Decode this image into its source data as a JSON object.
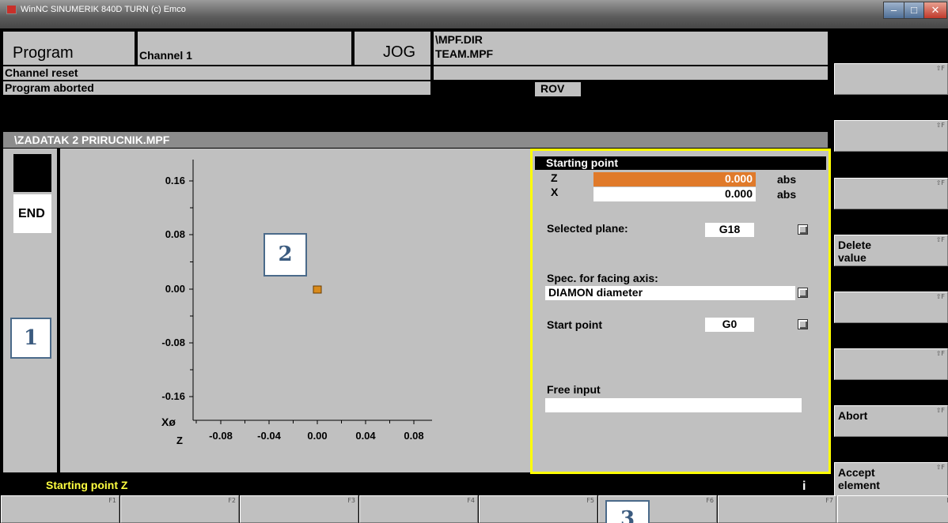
{
  "window": {
    "title": "WinNC SINUMERIK 840D TURN (c) Emco"
  },
  "header": {
    "area": "Program",
    "channel": "Channel 1",
    "mode": "JOG",
    "path_dir": "\\MPF.DIR",
    "path_file": "TEAM.MPF",
    "channel_status": "Channel reset",
    "program_status": "Program aborted",
    "rov": "ROV"
  },
  "program": {
    "file": "\\ZADATAK 2 PRIRUCNIK.MPF",
    "end_label": "END"
  },
  "plot": {
    "y_axis_label": "Xø",
    "x_axis_label": "Z",
    "y_ticks": [
      "0.16",
      "0.08",
      "0.00",
      "-0.08",
      "-0.16"
    ],
    "x_ticks": [
      "-0.08",
      "-0.04",
      "0.00",
      "0.04",
      "0.08"
    ],
    "start_point": {
      "z": 0.0,
      "x": 0.0
    }
  },
  "form": {
    "title": "Starting point",
    "z_label": "Z",
    "z_value": "0.000",
    "z_unit": "abs",
    "x_label": "X",
    "x_value": "0.000",
    "x_unit": "abs",
    "plane_label": "Selected plane:",
    "plane_value": "G18",
    "facing_label": "Spec. for facing axis:",
    "facing_value": "DIAMON diameter",
    "start_label": "Start point",
    "start_value": "G0",
    "free_label": "Free input",
    "free_value": ""
  },
  "status": {
    "message": "Starting point Z",
    "info": "i"
  },
  "vertical_softkeys": [
    {
      "label": "",
      "fn": "⇧F"
    },
    {
      "label": "",
      "fn": "⇧F"
    },
    {
      "label": "",
      "fn": "⇧F"
    },
    {
      "label": "Delete\nvalue",
      "fn": "⇧F"
    },
    {
      "label": "",
      "fn": "⇧F"
    },
    {
      "label": "",
      "fn": "⇧F"
    },
    {
      "label": "Abort",
      "fn": "⇧F"
    },
    {
      "label": "Accept\nelement",
      "fn": "⇧F"
    }
  ],
  "horizontal_softkeys": [
    "F1",
    "F2",
    "F3",
    "F4",
    "F5",
    "F6",
    "F7",
    "F"
  ],
  "annotations": [
    "1",
    "2",
    "3"
  ],
  "colors": {
    "panel_grey": "#c0c0c0",
    "highlight_orange": "#e07a2a",
    "frame_yellow": "#ffff00",
    "status_yellow": "#ffff40"
  }
}
